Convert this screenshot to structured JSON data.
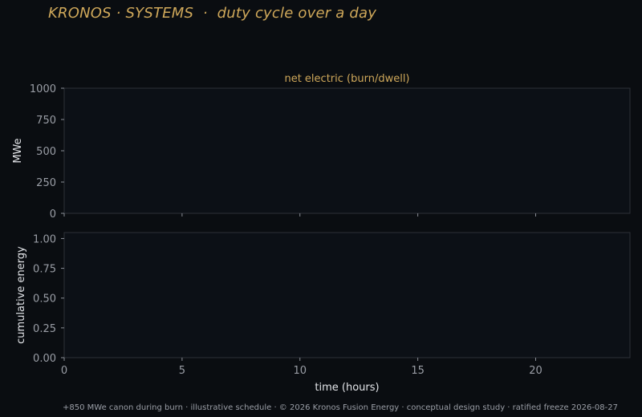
{
  "figure": {
    "suptitle": "KRONOS · SYSTEMS  ·  duty cycle over a day",
    "footer": "+850 MWe canon during burn · illustrative schedule · © 2026 Kronos Fusion Energy · conceptual design study · ratified freeze 2026-08-27",
    "colors": {
      "background": "#0a0d11",
      "axes_face": "#0c1016",
      "accent": "#cfa85a",
      "spine": "#2d3138",
      "tick_text": "#9a9ea6"
    }
  },
  "chart_data": [
    {
      "type": "line",
      "title": "net electric (burn/dwell)",
      "xlabel": "",
      "ylabel": "MWe",
      "xlim": [
        0,
        24
      ],
      "ylim": [
        0,
        1000
      ],
      "xticks": [
        0,
        5,
        10,
        15,
        20
      ],
      "xticklabels_shown": false,
      "yticks": [
        0,
        250,
        500,
        750,
        1000
      ],
      "yticklabels": [
        "0",
        "250",
        "500",
        "750",
        "1000"
      ],
      "grid": false,
      "series": []
    },
    {
      "type": "line",
      "title": "",
      "xlabel": "time (hours)",
      "ylabel": "cumulative energy",
      "xlim": [
        0,
        24
      ],
      "ylim": [
        0,
        1.05
      ],
      "xticks": [
        0,
        5,
        10,
        15,
        20
      ],
      "xticklabels": [
        "0",
        "5",
        "10",
        "15",
        "20"
      ],
      "xticklabels_shown": true,
      "yticks": [
        0,
        0.25,
        0.5,
        0.75,
        1.0
      ],
      "yticklabels": [
        "0.00",
        "0.25",
        "0.50",
        "0.75",
        "1.00"
      ],
      "grid": false,
      "series": []
    }
  ]
}
